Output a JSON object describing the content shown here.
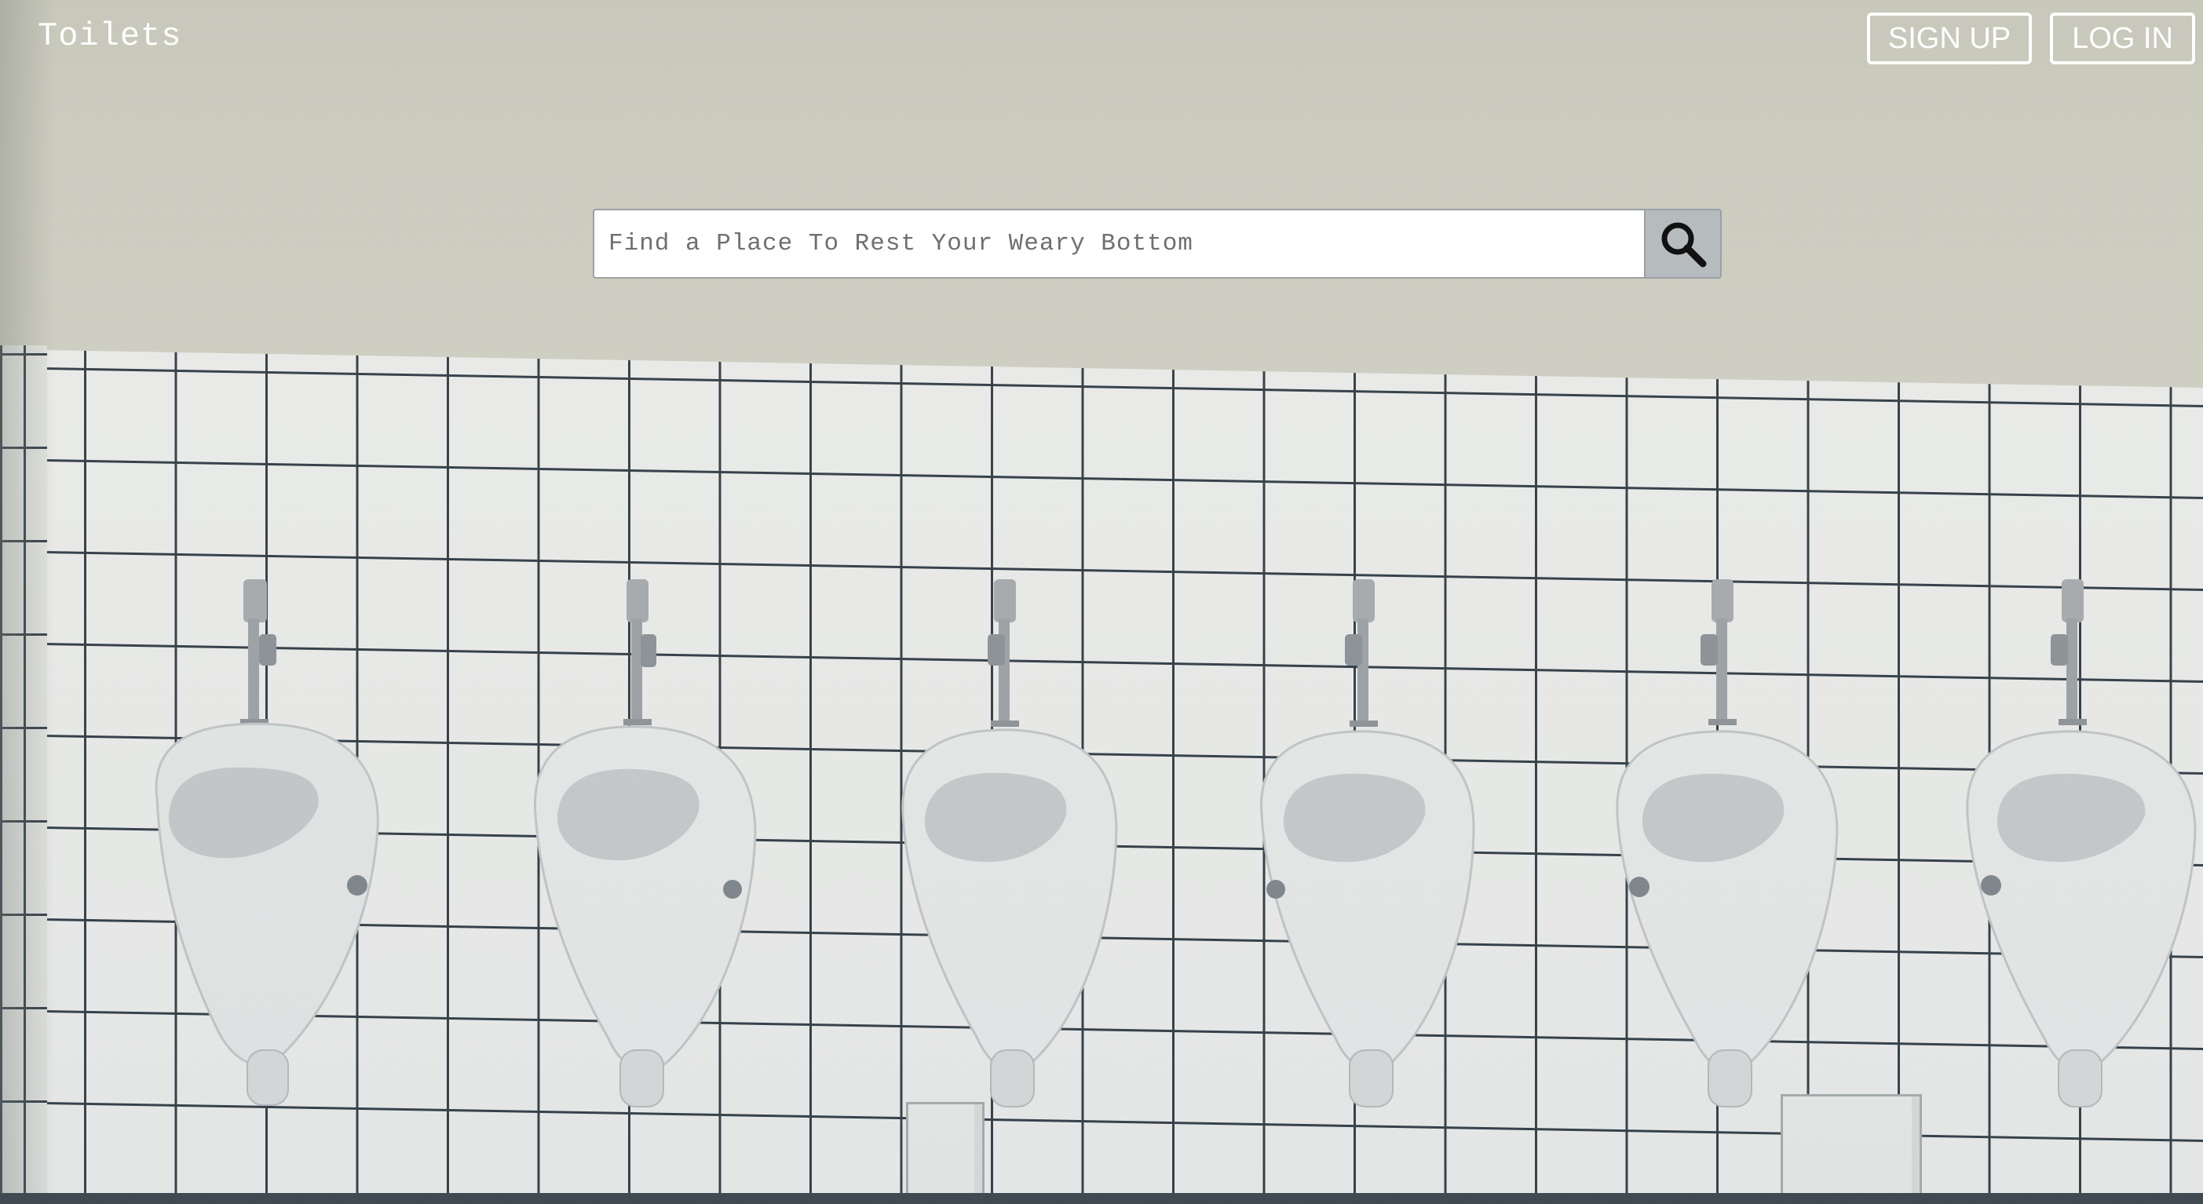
{
  "header": {
    "brand": "Toilets",
    "signup_label": "SIGN UP",
    "login_label": "LOG IN"
  },
  "search": {
    "placeholder": "Find a Place To Rest Your Weary Bottom",
    "value": "",
    "button_icon": "search-icon"
  },
  "background": {
    "description_icon": "urinals-photo",
    "urinal_count": 6
  },
  "colors": {
    "text_on_background": "#ffffff",
    "search_button_bg": "#b6bcbe",
    "input_border": "#9aa0a4"
  }
}
